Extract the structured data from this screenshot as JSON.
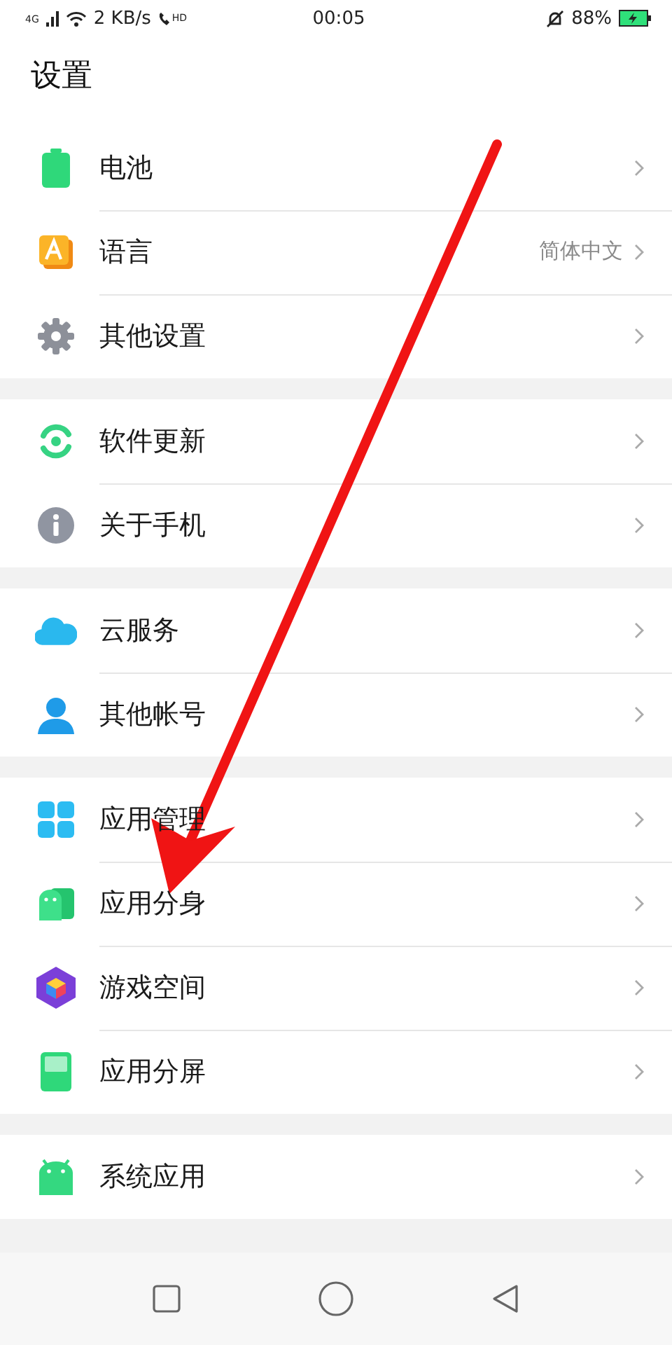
{
  "status_bar": {
    "network": "4G",
    "speed": "2 KB/s",
    "call_badge": "HD",
    "time": "00:05",
    "battery": "88%"
  },
  "title": "设置",
  "groups": [
    {
      "items": [
        {
          "label": "电池",
          "kind": "battery"
        },
        {
          "label": "语言",
          "kind": "language",
          "value": "简体中文"
        },
        {
          "label": "其他设置",
          "kind": "gear"
        }
      ]
    },
    {
      "items": [
        {
          "label": "软件更新",
          "kind": "update"
        },
        {
          "label": "关于手机",
          "kind": "info"
        }
      ]
    },
    {
      "items": [
        {
          "label": "云服务",
          "kind": "cloud"
        },
        {
          "label": "其他帐号",
          "kind": "person"
        }
      ]
    },
    {
      "items": [
        {
          "label": "应用管理",
          "kind": "grid"
        },
        {
          "label": "应用分身",
          "kind": "clone"
        },
        {
          "label": "游戏空间",
          "kind": "cube"
        },
        {
          "label": "应用分屏",
          "kind": "split"
        }
      ]
    },
    {
      "items": [
        {
          "label": "系统应用",
          "kind": "android"
        }
      ]
    }
  ]
}
